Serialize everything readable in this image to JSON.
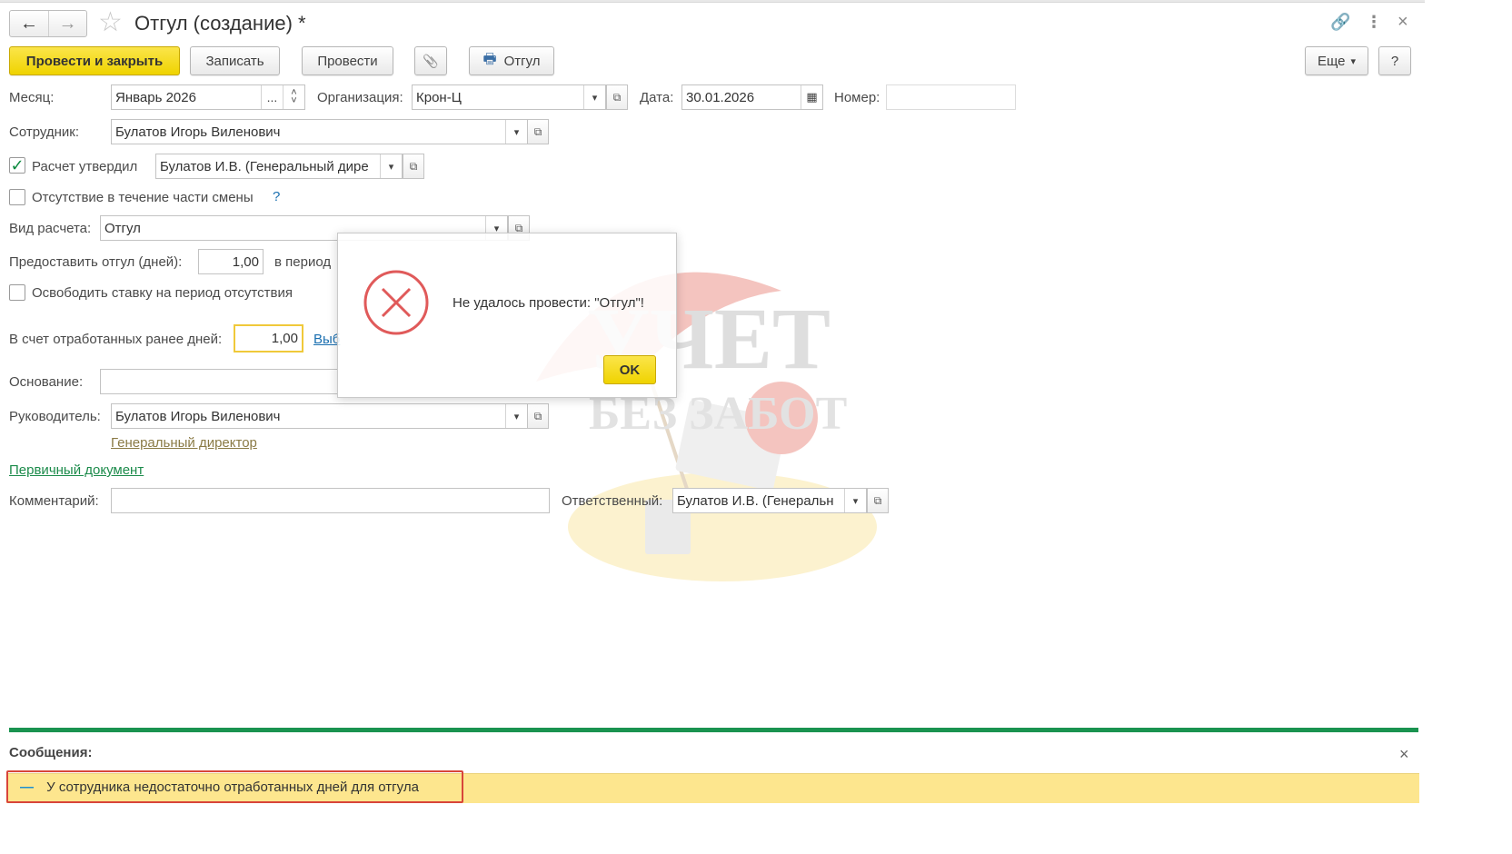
{
  "window": {
    "title": "Отгул (создание) *",
    "back_icon": "←",
    "forward_icon": "→",
    "favorite_icon": "☆",
    "link_icon": "🔗",
    "more_icon": "⋮",
    "close_icon": "×"
  },
  "toolbar": {
    "post_and_close": "Провести и закрыть",
    "save": "Записать",
    "post": "Провести",
    "attach_icon": "📎",
    "print_icon": "🖶",
    "print_label": "Отгул",
    "more": "Еще",
    "more_arrow": "▾",
    "help": "?"
  },
  "form": {
    "month_label": "Месяц:",
    "month_value": "Январь 2026",
    "month_select": "...",
    "spin_up": "˄",
    "spin_down": "˅",
    "org_label": "Организация:",
    "org_value": "Крон-Ц",
    "date_label": "Дата:",
    "date_value": "30.01.2026",
    "calendar_icon": "▦",
    "number_label": "Номер:",
    "number_value": "",
    "employee_label": "Сотрудник:",
    "employee_value": "Булатов Игорь Виленович",
    "approved_checked": "✓",
    "approved_label": "Расчет утвердил",
    "approved_value": "Булатов И.В. (Генеральный дире",
    "partial_shift_label": "Отсутствие в течение части смены",
    "partial_shift_help": "?",
    "calc_type_label": "Вид расчета:",
    "calc_type_value": "Отгул",
    "days_label": "Предоставить отгул (дней):",
    "days_value": "1,00",
    "period_label": "в период",
    "release_rate_label": "Освободить ставку на период отсутствия",
    "worked_days_label": "В счет отработанных ранее дней:",
    "worked_days_value": "1,00",
    "worked_days_link": "Выб",
    "basis_label": "Основание:",
    "basis_value": "",
    "manager_label": "Руководитель:",
    "manager_value": "Булатов Игорь Виленович",
    "manager_position": "Генеральный директор",
    "primary_doc_link": "Первичный документ",
    "comment_label": "Комментарий:",
    "comment_value": "",
    "responsible_label": "Ответственный:",
    "responsible_value": "Булатов И.В. (Генеральн",
    "dropdown_arrow": "▾",
    "open_icon": "⧉"
  },
  "dialog": {
    "message": "Не удалось провести: \"Отгул\"!",
    "ok": "OK"
  },
  "messages": {
    "title": "Сообщения:",
    "close_icon": "×",
    "items": [
      {
        "bullet": "—",
        "text": "У сотрудника недостаточно отработанных дней для отгула"
      }
    ]
  },
  "watermark": {
    "line1": "УЧЕТ",
    "line2": "БЕЗ ЗАБОТ"
  },
  "colors": {
    "primary_button": "#f4da1c",
    "error_icon": "#e05a5a",
    "message_bar": "#1a9350",
    "message_row": "#fde68e",
    "highlight_border": "#d8453a"
  }
}
